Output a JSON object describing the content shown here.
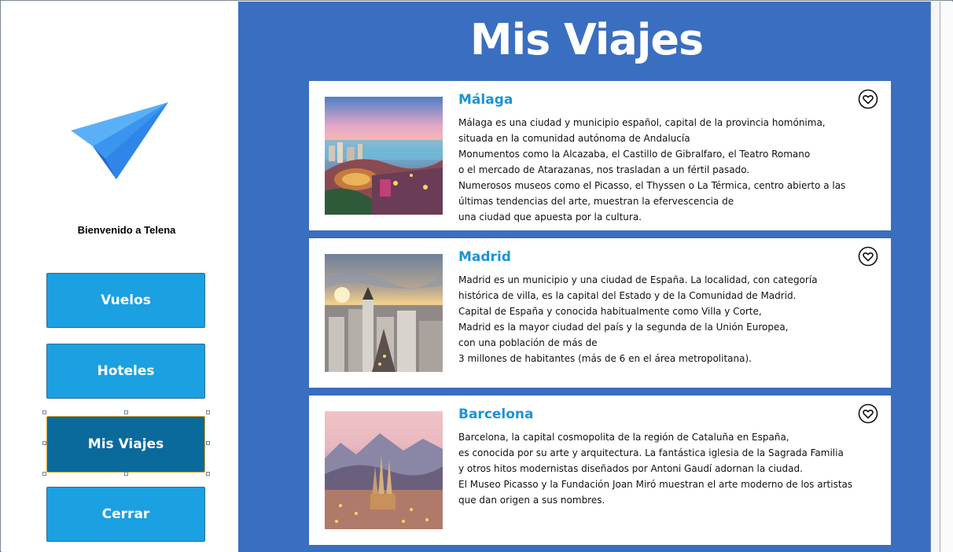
{
  "sidebar": {
    "welcome": "Bienvenido a Telena",
    "logo_icon": "paper-plane-icon",
    "buttons": [
      {
        "label": "Vuelos"
      },
      {
        "label": "Hoteles"
      },
      {
        "label": "Mis Viajes",
        "active": true
      },
      {
        "label": "Cerrar"
      }
    ]
  },
  "main": {
    "title": "Mis Viajes",
    "cards": [
      {
        "title": "Málaga",
        "lines": [
          "Málaga es una ciudad y municipio español, capital de la provincia homónima,",
          "situada en la comunidad autónoma de Andalucía",
          "Monumentos como la Alcazaba, el Castillo de Gibralfaro, el Teatro Romano",
          "o el mercado de Atarazanas, nos trasladan a un fértil pasado.",
          "Numerosos museos como el Picasso, el Thyssen o La Térmica, centro abierto a las",
          "últimas tendencias del arte, muestran la efervescencia de",
          "una ciudad que apuesta por la cultura."
        ],
        "favorite_icon": "heart-icon"
      },
      {
        "title": "Madrid",
        "lines": [
          "Madrid es un municipio y una ciudad de España. La localidad, con categoría",
          "histórica de villa, es la capital del Estado y de la Comunidad de Madrid.",
          "Capital de España y conocida habitualmente como Villa y Corte,",
          "Madrid es la mayor ciudad del país y la segunda de la Unión Europea,",
          "con una población de más de",
          "3 millones de habitantes (más de 6 en el área metropolitana)."
        ],
        "favorite_icon": "heart-icon"
      },
      {
        "title": "Barcelona",
        "lines": [
          "Barcelona, la capital cosmopolita de la región de Cataluña en España,",
          "es conocida por su arte y arquitectura. La fantástica iglesia de la Sagrada Familia",
          "y otros hitos modernistas diseñados por Antoni Gaudí adornan la ciudad.",
          "El Museo Picasso y la Fundación Joan Miró muestran el arte moderno de los artistas",
          "que dan origen a sus nombres."
        ],
        "favorite_icon": "heart-icon"
      }
    ]
  },
  "colors": {
    "main_bg": "#3a6ec0",
    "button_bg": "#1ba0e2",
    "button_active_bg": "#0b6a9c",
    "card_title": "#1b94d4"
  }
}
